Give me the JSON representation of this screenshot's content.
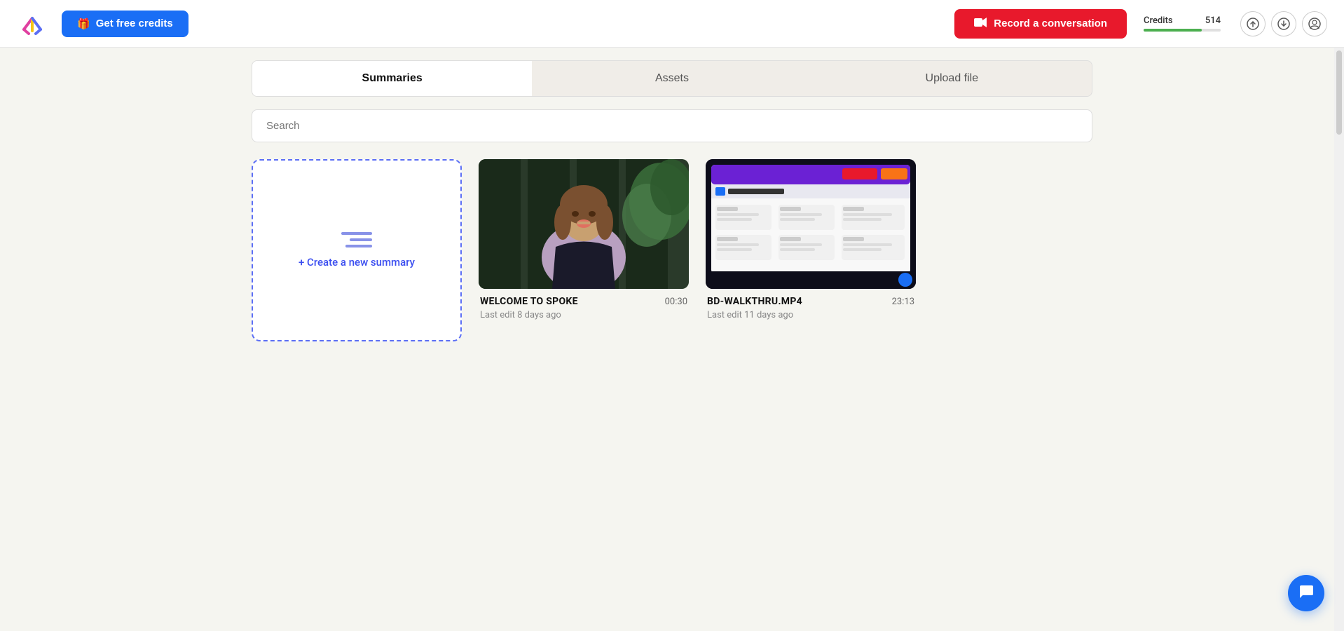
{
  "header": {
    "logo_alt": "Spoke logo",
    "free_credits_icon": "🎁",
    "free_credits_label": "Get free credits",
    "record_icon": "▶",
    "record_label": "Record a conversation",
    "credits_label": "Credits",
    "credits_value": "514",
    "upload_icon": "upload-icon",
    "download_icon": "download-icon",
    "profile_icon": "profile-icon"
  },
  "tabs": [
    {
      "id": "summaries",
      "label": "Summaries",
      "active": true
    },
    {
      "id": "assets",
      "label": "Assets",
      "active": false
    },
    {
      "id": "upload",
      "label": "Upload file",
      "active": false
    }
  ],
  "search": {
    "placeholder": "Search"
  },
  "create_card": {
    "label": "+ Create a new summary"
  },
  "videos": [
    {
      "id": "welcome-to-spoke",
      "title": "WELCOME TO SPOKE",
      "duration": "00:30",
      "last_edit": "Last edit 8 days ago",
      "thumb_type": "person"
    },
    {
      "id": "bd-walkthru",
      "title": "BD-WALKTHRU.MP4",
      "duration": "23:13",
      "last_edit": "Last edit 11 days ago",
      "thumb_type": "screen"
    }
  ],
  "chat": {
    "icon": "💬"
  }
}
